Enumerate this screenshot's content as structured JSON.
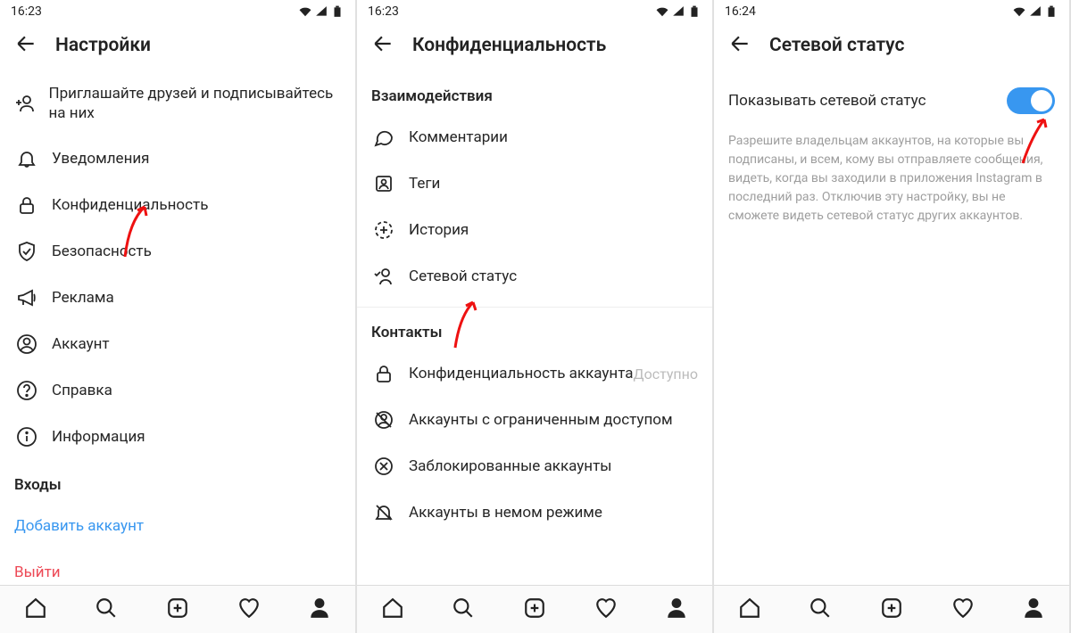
{
  "panels": [
    {
      "time": "16:23",
      "title": "Настройки",
      "items": [
        {
          "icon": "invite",
          "label": "Приглашайте друзей и подписывайтесь на них"
        },
        {
          "icon": "bell",
          "label": "Уведомления"
        },
        {
          "icon": "lock",
          "label": "Конфиденциальность"
        },
        {
          "icon": "shield",
          "label": "Безопасность"
        },
        {
          "icon": "megaphone",
          "label": "Реклама"
        },
        {
          "icon": "account",
          "label": "Аккаунт"
        },
        {
          "icon": "help",
          "label": "Справка"
        },
        {
          "icon": "info",
          "label": "Информация"
        }
      ],
      "section": "Входы",
      "links": [
        {
          "label": "Добавить аккаунт",
          "style": "blue"
        },
        {
          "label": "Выйти",
          "style": "red"
        }
      ]
    },
    {
      "time": "16:23",
      "title": "Конфиденциальность",
      "section1": "Взаимодействия",
      "items1": [
        {
          "icon": "comment",
          "label": "Комментарии"
        },
        {
          "icon": "tag",
          "label": "Теги"
        },
        {
          "icon": "story",
          "label": "История"
        },
        {
          "icon": "status",
          "label": "Сетевой статус"
        }
      ],
      "section2": "Контакты",
      "items2": [
        {
          "icon": "lock",
          "label": "Конфиденциальность аккаунта",
          "trailing": "Доступно"
        },
        {
          "icon": "restricted",
          "label": "Аккаунты с ограниченным доступом"
        },
        {
          "icon": "blocked",
          "label": "Заблокированные аккаунты"
        },
        {
          "icon": "mute",
          "label": "Аккаунты в немом режиме"
        }
      ]
    },
    {
      "time": "16:24",
      "title": "Сетевой статус",
      "toggle_label": "Показывать сетевой статус",
      "description": "Разрешите владельцам аккаунтов, на которые вы подписаны, и всем, кому вы отправляете сообщения, видеть, когда вы заходили в приложения Instagram в последний раз. Отключив эту настройку, вы не сможете видеть сетевой статус других аккаунтов."
    }
  ]
}
